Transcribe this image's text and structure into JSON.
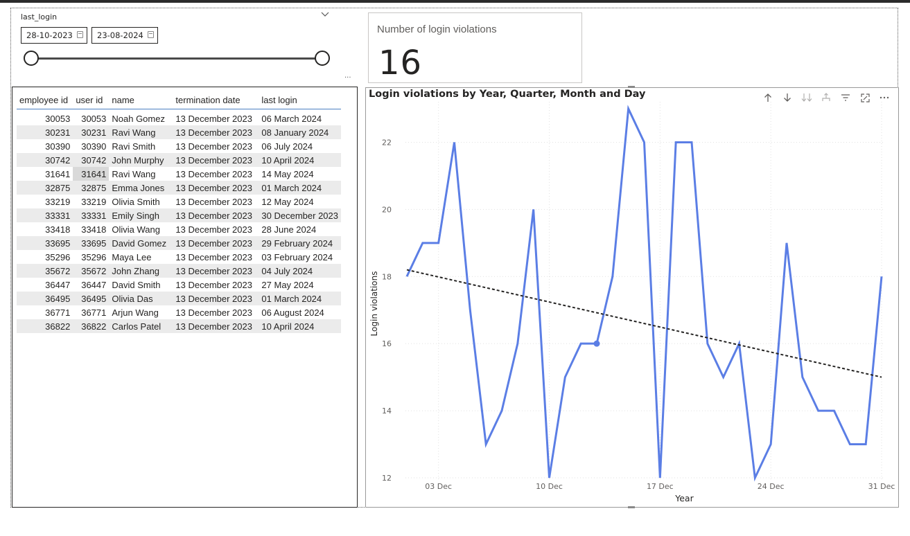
{
  "slicer": {
    "title": "last_login",
    "start_date": "28-10-2023",
    "end_date": "23-08-2024",
    "chevron_icon": "chevron-down-icon",
    "calendar_icon": "calendar-icon",
    "more_label": "..."
  },
  "card": {
    "title": "Number of login violations",
    "value": "16"
  },
  "table": {
    "columns": [
      "employee id",
      "user id",
      "name",
      "termination date",
      "last login"
    ],
    "rows": [
      [
        "30053",
        "30053",
        "Noah Gomez",
        "13 December 2023",
        "06 March 2024"
      ],
      [
        "30231",
        "30231",
        "Ravi Wang",
        "13 December 2023",
        "08 January 2024"
      ],
      [
        "30390",
        "30390",
        "Ravi Smith",
        "13 December 2023",
        "06 July 2024"
      ],
      [
        "30742",
        "30742",
        "John Murphy",
        "13 December 2023",
        "10 April 2024"
      ],
      [
        "31641",
        "31641",
        "Ravi Wang",
        "13 December 2023",
        "14 May 2024"
      ],
      [
        "32875",
        "32875",
        "Emma Jones",
        "13 December 2023",
        "01 March 2024"
      ],
      [
        "33219",
        "33219",
        "Olivia Smith",
        "13 December 2023",
        "12 May 2024"
      ],
      [
        "33331",
        "33331",
        "Emily Singh",
        "13 December 2023",
        "30 December 2023"
      ],
      [
        "33418",
        "33418",
        "Olivia Wang",
        "13 December 2023",
        "28 June 2024"
      ],
      [
        "33695",
        "33695",
        "David Gomez",
        "13 December 2023",
        "29 February 2024"
      ],
      [
        "35296",
        "35296",
        "Maya Lee",
        "13 December 2023",
        "03 February 2024"
      ],
      [
        "35672",
        "35672",
        "John Zhang",
        "13 December 2023",
        "04 July 2024"
      ],
      [
        "36447",
        "36447",
        "David Smith",
        "13 December 2023",
        "27 May 2024"
      ],
      [
        "36495",
        "36495",
        "Olivia Das",
        "13 December 2023",
        "01 March 2024"
      ],
      [
        "36771",
        "36771",
        "Arjun Wang",
        "13 December 2023",
        "06 August 2024"
      ],
      [
        "36822",
        "36822",
        "Carlos Patel",
        "13 December 2023",
        "10 April 2024"
      ]
    ]
  },
  "chart_toolbar": {
    "icons": [
      "drill-up-icon",
      "drill-down-icon",
      "expand-all-icon",
      "drill-hierarchy-icon",
      "filter-icon",
      "focus-mode-icon",
      "more-options-icon"
    ]
  },
  "chart_data": {
    "type": "line",
    "title": "Login violations by Year, Quarter, Month and Day",
    "xlabel": "Year",
    "ylabel": "Login violations",
    "x_tick_labels": [
      "03 Dec",
      "10 Dec",
      "17 Dec",
      "24 Dec",
      "31 Dec"
    ],
    "x_tick_days": [
      3,
      10,
      17,
      24,
      31
    ],
    "x_days": [
      1,
      2,
      3,
      4,
      5,
      6,
      7,
      8,
      9,
      10,
      11,
      12,
      13,
      14,
      15,
      16,
      17,
      18,
      19,
      20,
      21,
      22,
      23,
      24,
      25,
      26,
      27,
      28,
      29,
      30,
      31
    ],
    "values": [
      18,
      19,
      19,
      22,
      17,
      13,
      14,
      16,
      20,
      12,
      15,
      16,
      16,
      18,
      23,
      22,
      12,
      22,
      22,
      16,
      15,
      16,
      12,
      13,
      19,
      15,
      14,
      14,
      13,
      13,
      18
    ],
    "trend_line": {
      "start": 18.2,
      "end": 15.0
    },
    "highlight_day": 13,
    "ylim": [
      12,
      23
    ],
    "y_ticks": [
      12,
      14,
      16,
      18,
      20,
      22
    ],
    "series_color": "#5b7ee5",
    "grid": true
  }
}
